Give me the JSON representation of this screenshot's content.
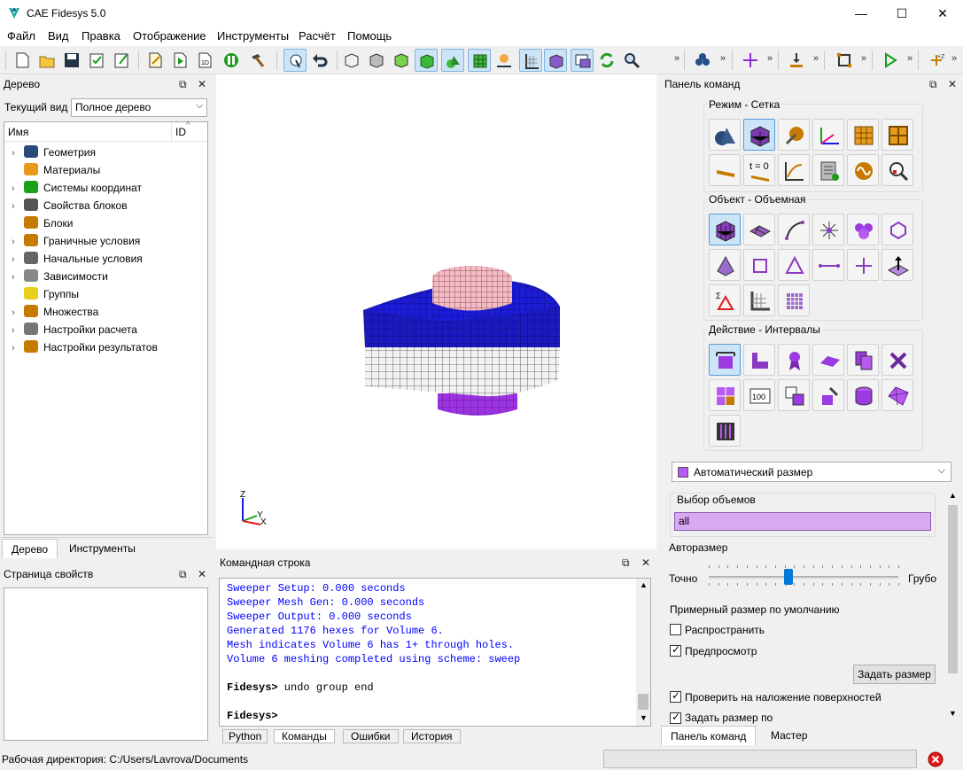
{
  "window": {
    "title": "CAE Fidesys 5.0",
    "minimize": "—",
    "maximize": "☐",
    "close": "✕"
  },
  "menu": [
    "Файл",
    "Вид",
    "Правка",
    "Отображение",
    "Инструменты",
    "Расчёт",
    "Помощь"
  ],
  "tree_panel": {
    "title": "Дерево",
    "view_label": "Текущий вид",
    "view_value": "Полное дерево",
    "col_name": "Имя",
    "col_id": "ID",
    "items": [
      {
        "label": "Геометрия",
        "expandable": true,
        "icon": "geometry-icon"
      },
      {
        "label": "Материалы",
        "expandable": false,
        "icon": "materials-icon"
      },
      {
        "label": "Системы координат",
        "expandable": true,
        "icon": "coordinate-systems-icon"
      },
      {
        "label": "Свойства блоков",
        "expandable": true,
        "icon": "block-properties-icon"
      },
      {
        "label": "Блоки",
        "expandable": false,
        "icon": "blocks-icon"
      },
      {
        "label": "Граничные условия",
        "expandable": true,
        "icon": "boundary-conditions-icon"
      },
      {
        "label": "Начальные условия",
        "expandable": true,
        "icon": "initial-conditions-icon"
      },
      {
        "label": "Зависимости",
        "expandable": true,
        "icon": "dependencies-icon"
      },
      {
        "label": "Группы",
        "expandable": false,
        "icon": "groups-icon"
      },
      {
        "label": "Множества",
        "expandable": true,
        "icon": "sets-icon"
      },
      {
        "label": "Настройки расчета",
        "expandable": true,
        "icon": "calc-settings-icon"
      },
      {
        "label": "Настройки результатов",
        "expandable": true,
        "icon": "results-settings-icon"
      }
    ],
    "tabs": [
      "Дерево",
      "Инструменты"
    ]
  },
  "properties_panel": {
    "title": "Страница свойств"
  },
  "console": {
    "title": "Командная строка",
    "lines": [
      {
        "text": "Sweeper Setup: 0.000 seconds",
        "style": "blue"
      },
      {
        "text": "Sweeper Mesh Gen: 0.000 seconds",
        "style": "blue"
      },
      {
        "text": "Sweeper Output: 0.000 seconds",
        "style": "blue"
      },
      {
        "text": "Generated 1176 hexes for Volume 6.",
        "style": "blue"
      },
      {
        "text": "Mesh indicates Volume 6 has 1+ through holes.",
        "style": "blue"
      },
      {
        "text": "Volume 6 meshing completed using scheme: sweep",
        "style": "blue"
      },
      {
        "text": "",
        "style": "blue"
      },
      {
        "prompt": "Fidesys>",
        "text": " undo group end",
        "style": "prompt"
      },
      {
        "text": "",
        "style": "blue"
      },
      {
        "prompt": "Fidesys>",
        "text": "",
        "style": "prompt"
      }
    ],
    "tabs": [
      "Python",
      "Команды",
      "Ошибки",
      "История"
    ]
  },
  "viewport": {
    "axis_z": "Z",
    "axis_y": "Y",
    "axis_x": "X"
  },
  "command_panel": {
    "title": "Панель команд",
    "mode_group": "Режим - Сетка",
    "object_group": "Объект - Объемная",
    "action_group": "Действие - Интервалы",
    "scheme_value": "Автоматический размер",
    "volumes_label": "Выбор объемов",
    "volumes_value": "all",
    "autosize_label": "Авторазмер",
    "slider_left": "Точно",
    "slider_right": "Грубо",
    "slider_position": 0.42,
    "approx_label": "Примерный размер  по умолчанию",
    "propagate_label": "Распространить",
    "propagate_checked": false,
    "preview_label": "Предпросмотр",
    "preview_checked": true,
    "set_size_button": "Задать размер",
    "check_overlap_label": "Проверить на наложение поверхностей",
    "check_overlap_checked": true,
    "set_size_by_label": "Задать размер по",
    "set_size_by_checked": true,
    "bottom_tabs": [
      "Панель команд",
      "Мастер"
    ]
  },
  "status": {
    "workdir": "Рабочая директория: C:/Users/Lavrova/Documents"
  },
  "colors": {
    "accent": "#cce4f7",
    "mesh_blue": "#1a1acc",
    "mesh_pink": "#f0b8c0",
    "mesh_gray": "#e8e8e8",
    "mesh_purple": "#9933dd"
  }
}
